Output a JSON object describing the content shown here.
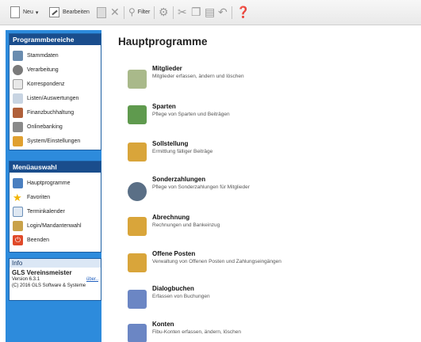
{
  "toolbar": {
    "neu_label": "Neu",
    "bearbeiten_label": "Bearbeiten",
    "filter_label": "Filter"
  },
  "sidebar": {
    "programmbereiche": {
      "title": "Programmbereiche",
      "items": [
        {
          "label": "Stammdaten",
          "icon": "person-card-icon"
        },
        {
          "label": "Verarbeitung",
          "icon": "gear-icon"
        },
        {
          "label": "Korrespondenz",
          "icon": "envelope-icon"
        },
        {
          "label": "Listen/Auswertungen",
          "icon": "pencil-list-icon"
        },
        {
          "label": "Finanzbuchhaltung",
          "icon": "binder-icon"
        },
        {
          "label": "Onlinebanking",
          "icon": "bank-icon"
        },
        {
          "label": "System/Einstellungen",
          "icon": "settings-icon"
        }
      ]
    },
    "menueauswahl": {
      "title": "Menüauswahl",
      "items": [
        {
          "label": "Hauptprogramme",
          "icon": "window-edit-icon"
        },
        {
          "label": "Favoriten",
          "icon": "star-icon"
        },
        {
          "label": "Terminkalender",
          "icon": "calendar-icon"
        },
        {
          "label": "Login/Mandantenwahl",
          "icon": "user-key-icon"
        },
        {
          "label": "Beenden",
          "icon": "power-icon"
        }
      ]
    },
    "info": {
      "title": "Info",
      "app_name": "GLS Vereinsmeister",
      "version": "Version 6.3.1",
      "about_link": "über..",
      "copyright": "(C) 2016 GLS Software & Systeme"
    }
  },
  "main": {
    "title": "Hauptprogramme",
    "entries": [
      {
        "title": "Mitglieder",
        "desc": "Mitglieder erfassen, ändern und löschen"
      },
      {
        "title": "Sparten",
        "desc": "Pflege von Sparten und Beiträgen"
      },
      {
        "title": "Sollstellung",
        "desc": "Ermittlung fälliger Beiträge"
      },
      {
        "title": "Sonderzahlungen",
        "desc": "Pflege von Sonderzahlungen für Mitglieder"
      },
      {
        "title": "Abrechnung",
        "desc": "Rechnungen und Bankeinzug"
      },
      {
        "title": "Offene Posten",
        "desc": "Verwaltung von Offenen Posten und Zahlungseingängen"
      },
      {
        "title": "Dialogbuchen",
        "desc": "Erfassen von Buchungen"
      },
      {
        "title": "Konten",
        "desc": "Fibu-Konten erfassen, ändern, löschen"
      }
    ]
  },
  "colors": {
    "sidebar_bg": "#2d8bdc",
    "panel_header": "#1a4d8c",
    "link": "#1f5fbf"
  }
}
